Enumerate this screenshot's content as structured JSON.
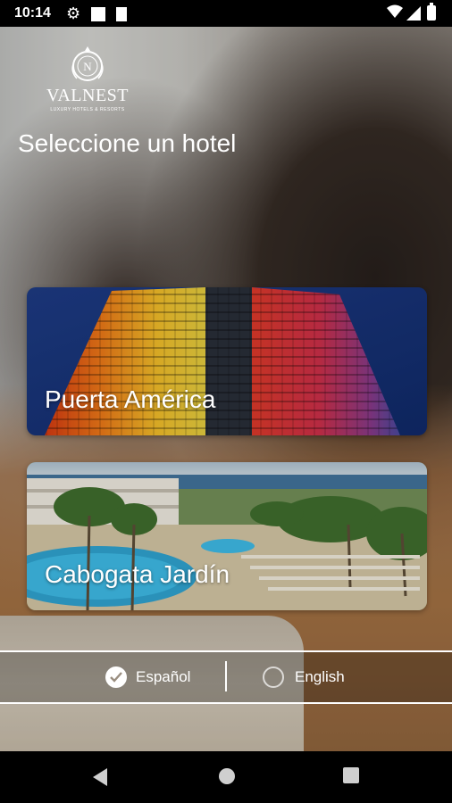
{
  "status_bar": {
    "time": "10:14"
  },
  "brand": {
    "name": "VALNEST",
    "tagline": "LUXURY HOTELS & RESORTS",
    "monogram": "N"
  },
  "page": {
    "title": "Seleccione un hotel"
  },
  "hotels": [
    {
      "name": "Puerta América"
    },
    {
      "name": "Cabogata Jardín"
    }
  ],
  "languages": [
    {
      "label": "Español",
      "selected": true
    },
    {
      "label": "English",
      "selected": false
    }
  ],
  "colors": {
    "accent": "#ffffff",
    "status_bar": "#000000"
  }
}
